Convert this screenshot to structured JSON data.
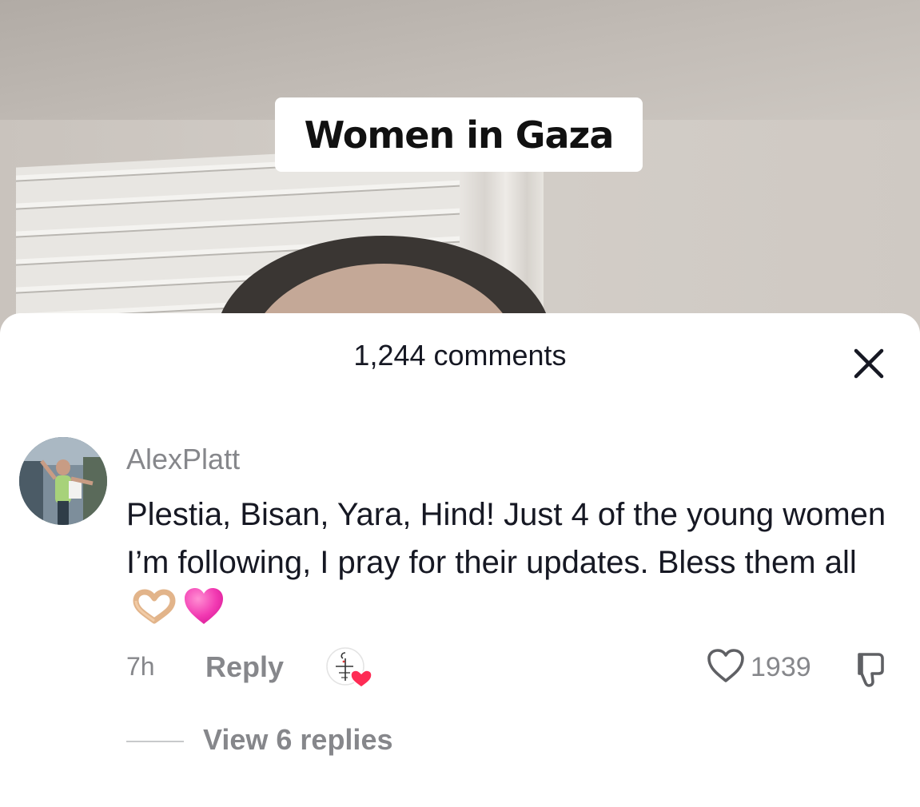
{
  "video": {
    "caption": "Women in Gaza"
  },
  "sheet": {
    "comments_count": "1,244 comments",
    "close_icon": "close-icon"
  },
  "comment": {
    "username": "AlexPlatt",
    "text": "Plestia, Bisan, Yara, Hind! Just 4 of the young women I’m following, I pray for their updates. Bless them all",
    "emojis": [
      "heart-hands-emoji",
      "pink-heart-emoji"
    ],
    "time": "7h",
    "reply_label": "Reply",
    "likes": "1939",
    "view_replies": "View 6 replies"
  },
  "colors": {
    "primary_text": "#161823",
    "secondary_text": "#86878b",
    "heart_red": "#fe2c55",
    "sheet_bg": "#ffffff"
  }
}
